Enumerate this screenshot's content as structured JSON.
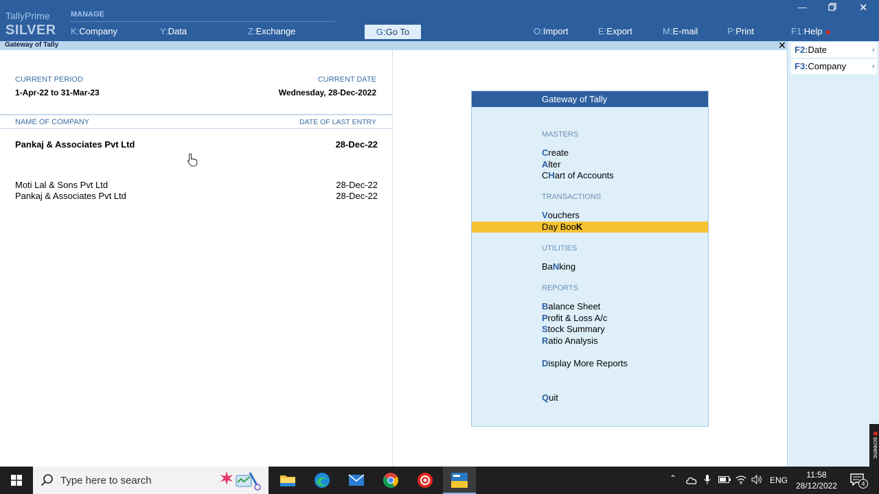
{
  "brand": {
    "name": "TallyPrime",
    "edition": "SILVER"
  },
  "toolbar": {
    "manage_label": "MANAGE",
    "company": {
      "key": "K",
      "label": "Company"
    },
    "data": {
      "key": "Y",
      "label": "Data"
    },
    "exchange": {
      "key": "Z",
      "label": "Exchange"
    },
    "goto": {
      "key": "G",
      "label": "Go To"
    },
    "import": {
      "key": "O",
      "label": "Import"
    },
    "export": {
      "key": "E",
      "label": "Export"
    },
    "email": {
      "key": "M",
      "label": "E-mail"
    },
    "print": {
      "key": "P",
      "label": "Print"
    },
    "help": {
      "key": "F1",
      "label": "Help"
    }
  },
  "window_title": "Gateway of Tally",
  "info": {
    "current_period_label": "CURRENT PERIOD",
    "current_period": "1-Apr-22 to 31-Mar-23",
    "current_date_label": "CURRENT DATE",
    "current_date": "Wednesday, 28-Dec-2022",
    "name_of_company_label": "NAME OF COMPANY",
    "date_of_last_entry_label": "DATE OF LAST ENTRY",
    "active_company": {
      "name": "Pankaj & Associates Pvt Ltd",
      "date": "28-Dec-22"
    },
    "companies": [
      {
        "name": "Moti Lal & Sons Pvt Ltd",
        "date": "28-Dec-22"
      },
      {
        "name": "Pankaj & Associates Pvt Ltd",
        "date": "28-Dec-22"
      }
    ]
  },
  "gateway": {
    "title": "Gateway of Tally",
    "sections": {
      "masters": "MASTERS",
      "transactions": "TRANSACTIONS",
      "utilities": "UTILITIES",
      "reports": "REPORTS"
    },
    "items": {
      "create": {
        "hk": "C",
        "rest": "reate"
      },
      "alter": {
        "hk": "A",
        "rest": "lter"
      },
      "chart": {
        "pre": "C",
        "hk": "H",
        "rest": "art of Accounts"
      },
      "vouchers": {
        "hk": "V",
        "rest": "ouchers"
      },
      "daybook": {
        "pre": "Day Boo",
        "hk": "K"
      },
      "banking": {
        "pre": "Ba",
        "hk": "N",
        "rest": "king"
      },
      "balance": {
        "hk": "B",
        "rest": "alance Sheet"
      },
      "profit": {
        "hk": "P",
        "rest": "rofit & Loss A/c"
      },
      "stock": {
        "hk": "S",
        "rest": "tock Summary"
      },
      "ratio": {
        "hk": "R",
        "rest": "atio Analysis"
      },
      "display_more": {
        "hk": "D",
        "rest": "isplay More Reports"
      },
      "quit": {
        "hk": "Q",
        "rest": "uit"
      }
    },
    "selected": "Day BooK"
  },
  "right_panel": {
    "date": {
      "key": "F2",
      "label": "Date"
    },
    "company": {
      "key": "F3",
      "label": "Company"
    }
  },
  "screencast_label": "screenc",
  "taskbar": {
    "search_placeholder": "Type here to search",
    "lang": "ENG",
    "time": "11:58",
    "date": "28/12/2022",
    "notifications": "4"
  },
  "colors": {
    "topbar": "#2d5f9e",
    "accent_light": "#9fc3ea",
    "panel_bg": "#deeff9",
    "selection": "#f5c231"
  }
}
